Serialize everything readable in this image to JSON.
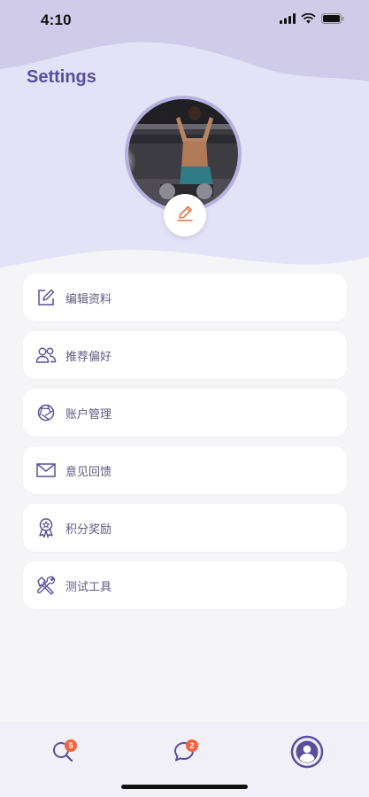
{
  "status_bar": {
    "time": "4:10"
  },
  "header": {
    "title": "Settings"
  },
  "menu": [
    {
      "label": "编辑资料",
      "icon": "edit-square-icon"
    },
    {
      "label": "推荐偏好",
      "icon": "users-icon"
    },
    {
      "label": "账户管理",
      "icon": "aperture-icon"
    },
    {
      "label": "意见回馈",
      "icon": "mail-icon"
    },
    {
      "label": "积分奖励",
      "icon": "award-icon"
    },
    {
      "label": "测试工具",
      "icon": "tools-icon"
    }
  ],
  "tabbar": {
    "search_badge": "5",
    "chat_badge": "2"
  },
  "colors": {
    "accent": "#5a4f9a",
    "header_background": "#e4e2f7",
    "wave": "#cfcbe9",
    "badge": "#f0643e",
    "pencil": "#e2774a"
  }
}
